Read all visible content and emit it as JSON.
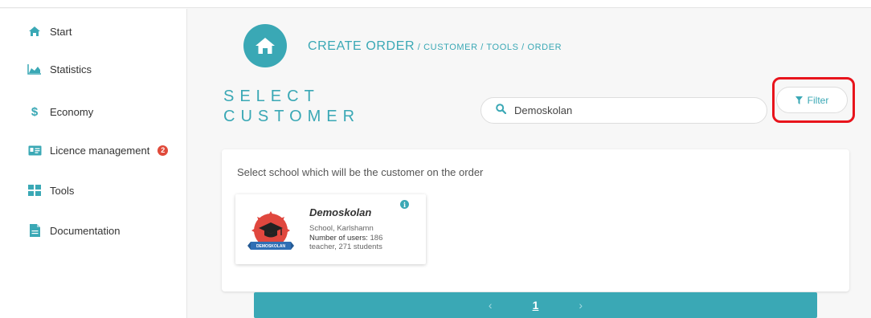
{
  "sidebar": {
    "items": [
      {
        "label": "Start",
        "icon": "home-icon"
      },
      {
        "label": "Statistics",
        "icon": "area-chart-icon"
      },
      {
        "label": "Economy",
        "icon": "dollar-icon"
      },
      {
        "label": "Licence management",
        "icon": "id-card-icon",
        "badge": "2"
      },
      {
        "label": "Tools",
        "icon": "grid-icon"
      },
      {
        "label": "Documentation",
        "icon": "document-icon"
      }
    ]
  },
  "breadcrumb": {
    "main": "CREATE ORDER",
    "rest": " / CUSTOMER / TOOLS / ORDER"
  },
  "page": {
    "title_line1": "SELECT",
    "title_line2": "CUSTOMER"
  },
  "search": {
    "value": "Demoskolan"
  },
  "filter": {
    "label": "Filter"
  },
  "panel": {
    "caption": "Select school which will be the customer on the order"
  },
  "school": {
    "name": "Demoskolan",
    "type_city": "School, Karlshamn",
    "users_label": "Number of users:",
    "users_value": " 186",
    "users_detail": "teacher, 271 students",
    "logo_text": "DEMOSKOLAN"
  },
  "pagination": {
    "prev": "‹",
    "page": "1",
    "next": "›"
  },
  "colors": {
    "accent": "#3aa8b5",
    "badge": "#e04a3a",
    "highlight": "#e8141c",
    "logo_red": "#e0473e",
    "logo_ribbon": "#2f6fb5"
  }
}
